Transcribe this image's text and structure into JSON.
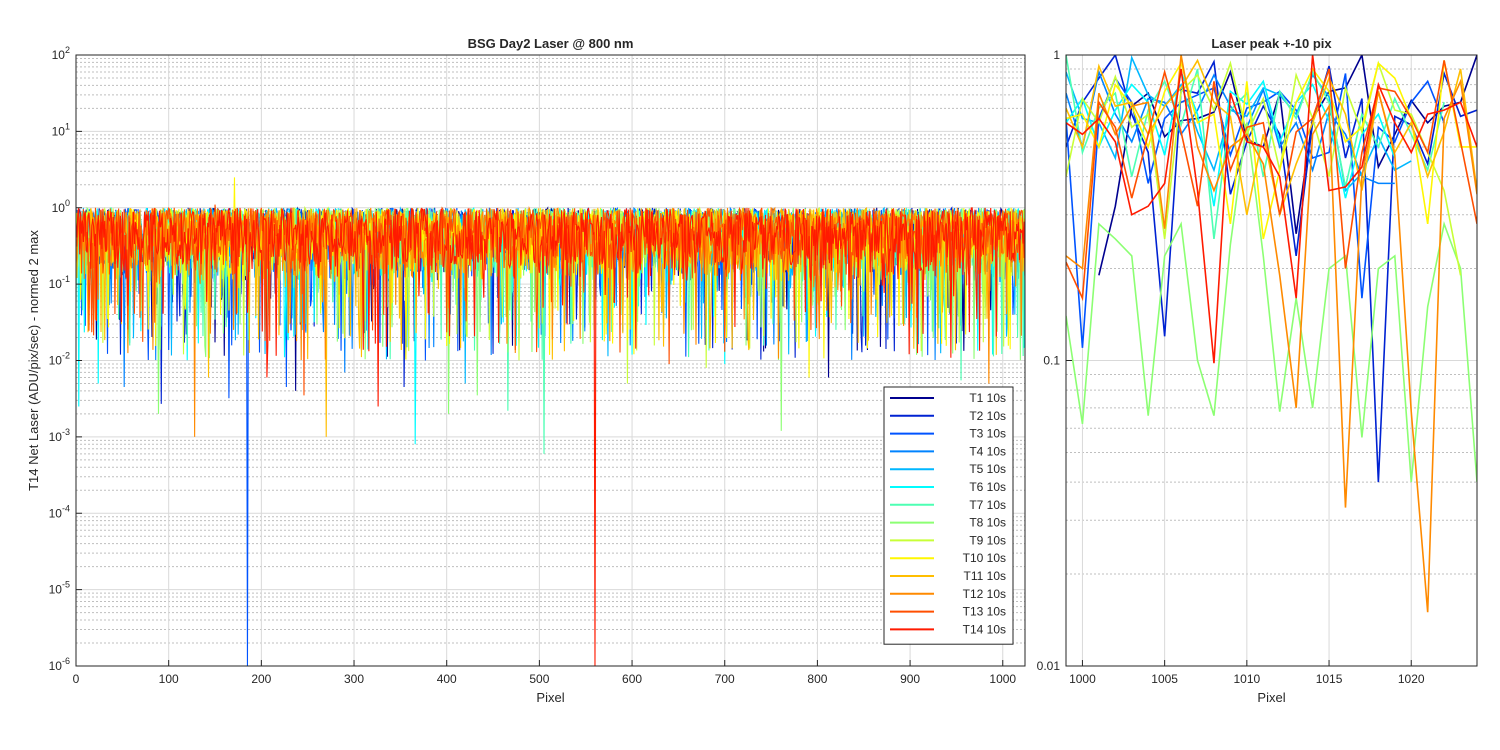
{
  "chart_data": [
    {
      "type": "line",
      "title": "BSG  Day2 Laser @ 800 nm",
      "xlabel": "Pixel",
      "ylabel": "T14 Net Laser (ADU/pix/sec) - normed 2 max",
      "yscale": "log",
      "xlim": [
        0,
        1024
      ],
      "ylim": [
        1e-06,
        100
      ],
      "xticks": [
        0,
        100,
        200,
        300,
        400,
        500,
        600,
        700,
        800,
        900,
        1000
      ],
      "ytick_exponents": [
        -6,
        -5,
        -4,
        -3,
        -2,
        -1,
        0,
        1,
        2
      ],
      "grid": true,
      "minor_grid": true,
      "legend_position": "bottom-right",
      "noise_band": [
        0.1,
        1.0
      ],
      "series": [
        {
          "name": "T1 10s",
          "color": "#00008f",
          "dips": [
            [
              237,
              0.004
            ],
            [
              812,
              0.006
            ]
          ]
        },
        {
          "name": "T2 10s",
          "color": "#0022d2",
          "dips": [
            [
              92,
              0.0027
            ],
            [
              354,
              0.0045
            ]
          ]
        },
        {
          "name": "T3 10s",
          "color": "#0053ff",
          "dips": [
            [
              185,
              1e-06
            ],
            [
              165,
              0.0032
            ],
            [
              227,
              0.0045
            ]
          ]
        },
        {
          "name": "T4 10s",
          "color": "#0083ff",
          "dips": [
            [
              52,
              0.0045
            ],
            [
              290,
              0.007
            ]
          ]
        },
        {
          "name": "T5 10s",
          "color": "#00b7ff",
          "dips": [
            [
              420,
              0.005
            ]
          ]
        },
        {
          "name": "T6 10s",
          "color": "#00fcff",
          "dips": [
            [
              366,
              0.0008
            ],
            [
              3,
              0.0025
            ],
            [
              24,
              0.005
            ],
            [
              700,
              0.009
            ]
          ]
        },
        {
          "name": "T7 10s",
          "color": "#4dffb3",
          "dips": [
            [
              505,
              0.0006
            ],
            [
              466,
              0.0022
            ],
            [
              955,
              0.0055
            ]
          ]
        },
        {
          "name": "T8 10s",
          "color": "#8cff73",
          "dips": [
            [
              89,
              0.002
            ],
            [
              761,
              0.0012
            ],
            [
              402,
              0.002
            ],
            [
              433,
              0.0035
            ]
          ]
        },
        {
          "name": "T9 10s",
          "color": "#c8ff37",
          "dips": [
            [
              595,
              0.005
            ],
            [
              680,
              0.008
            ]
          ]
        },
        {
          "name": "T10 10s",
          "color": "#fff700",
          "dips": [
            [
              171,
              0.0055
            ],
            [
              791,
              0.006
            ]
          ]
        },
        {
          "name": "T11 10s",
          "color": "#ffbe00",
          "dips": [
            [
              270,
              0.001
            ],
            [
              143,
              0.006
            ]
          ]
        },
        {
          "name": "T12 10s",
          "color": "#ff8a00",
          "dips": [
            [
              128,
              0.001
            ],
            [
              985,
              0.005
            ]
          ]
        },
        {
          "name": "T13 10s",
          "color": "#ff4f00",
          "dips": [
            [
              246,
              0.0035
            ],
            [
              640,
              0.009
            ]
          ]
        },
        {
          "name": "T14 10s",
          "color": "#ff1a00",
          "dips": [
            [
              560,
              1e-06
            ],
            [
              326,
              0.0025
            ],
            [
              206,
              0.006
            ]
          ]
        }
      ],
      "spikes": [
        [
          171,
          2.5,
          "T10 10s"
        ],
        [
          150,
          1.1,
          "T13 10s"
        ]
      ]
    },
    {
      "type": "line",
      "title": "Laser peak +-10 pix",
      "xlabel": "Pixel",
      "ylabel": "",
      "yscale": "log",
      "xlim": [
        999,
        1024
      ],
      "ylim": [
        0.01,
        1
      ],
      "xticks": [
        1000,
        1005,
        1010,
        1015,
        1020
      ],
      "ytick_exponents": [
        -2,
        -1,
        0
      ],
      "grid": true,
      "minor_grid": true,
      "series": [
        {
          "name": "T1 10s",
          "color": "#00008f",
          "x": [
            1001,
            1002,
            1003,
            1004,
            1005,
            1006,
            1007,
            1008,
            1009,
            1010,
            1011,
            1012,
            1013,
            1014,
            1015,
            1016,
            1017,
            1018,
            1019,
            1020,
            1021,
            1022,
            1023,
            1024
          ],
          "y": [
            0.19,
            0.32,
            0.68,
            0.75,
            0.54,
            0.61,
            0.62,
            0.65,
            0.88,
            0.53,
            0.5,
            0.75,
            0.26,
            0.62,
            0.76,
            0.78,
            1.0,
            0.43,
            0.55,
            0.71,
            0.6,
            0.68,
            0.7,
            1.0
          ]
        },
        {
          "name": "T2 10s",
          "color": "#0022d2",
          "x": [
            999,
            1000,
            1001,
            1002,
            1003,
            1004,
            1005,
            1006,
            1007,
            1008,
            1009,
            1010,
            1011,
            1012,
            1013,
            1014,
            1015,
            1016,
            1017,
            1018,
            1019,
            1020,
            1021,
            1022,
            1023,
            1024
          ],
          "y": [
            0.5,
            0.7,
            0.84,
            1.0,
            0.64,
            0.48,
            0.12,
            0.77,
            0.75,
            0.95,
            0.35,
            0.52,
            0.68,
            0.55,
            0.22,
            0.6,
            0.92,
            0.46,
            0.72,
            0.04,
            0.63,
            0.59,
            0.44,
            0.87,
            0.63,
            0.66
          ]
        },
        {
          "name": "T3 10s",
          "color": "#0053ff",
          "x": [
            999,
            1000,
            1001,
            1002,
            1003,
            1004,
            1005,
            1006,
            1007,
            1008,
            1009,
            1010,
            1011,
            1012,
            1013,
            1014,
            1015,
            1016,
            1017,
            1018,
            1019,
            1020,
            1021,
            1022
          ],
          "y": [
            0.62,
            0.11,
            0.62,
            0.84,
            0.7,
            0.38,
            0.62,
            0.7,
            0.74,
            0.78,
            0.47,
            0.67,
            0.7,
            0.76,
            0.66,
            0.46,
            0.48,
            0.87,
            0.16,
            0.58,
            0.52,
            0.7,
            0.82,
            0.6
          ]
        },
        {
          "name": "T4 10s",
          "color": "#0083ff",
          "x": [
            999,
            1000,
            1001,
            1002,
            1003,
            1004,
            1005,
            1006,
            1007,
            1008,
            1009,
            1010,
            1011,
            1012,
            1013,
            1014,
            1015,
            1016,
            1017,
            1018,
            1019
          ],
          "y": [
            0.75,
            0.5,
            0.88,
            0.64,
            0.52,
            0.72,
            0.7,
            0.55,
            0.66,
            0.86,
            0.68,
            0.58,
            0.77,
            0.5,
            0.6,
            0.42,
            0.65,
            0.55,
            0.4,
            0.38,
            0.38
          ]
        },
        {
          "name": "T5 10s",
          "color": "#00b7ff",
          "x": [
            999,
            1000,
            1001,
            1002,
            1003,
            1004,
            1005,
            1006,
            1007,
            1008,
            1009,
            1010,
            1011,
            1012,
            1013,
            1014,
            1015,
            1016,
            1017,
            1018,
            1019,
            1020
          ],
          "y": [
            0.88,
            0.62,
            0.6,
            0.46,
            0.98,
            0.74,
            0.68,
            0.8,
            0.56,
            0.42,
            0.66,
            0.63,
            0.78,
            0.74,
            0.64,
            0.86,
            0.73,
            0.36,
            0.41,
            0.54,
            0.42,
            0.45
          ]
        },
        {
          "name": "T6 10s",
          "color": "#00fcff",
          "x": [
            999,
            1000,
            1001,
            1002,
            1003,
            1004,
            1005,
            1006,
            1007,
            1008,
            1009,
            1010,
            1011,
            1012,
            1013,
            1014,
            1015,
            1016,
            1017,
            1018,
            1019
          ],
          "y": [
            0.6,
            0.72,
            0.5,
            0.66,
            0.8,
            0.7,
            0.47,
            0.88,
            0.64,
            0.32,
            0.76,
            0.69,
            0.82,
            0.52,
            0.7,
            0.8,
            0.61,
            0.34,
            0.55,
            0.64,
            0.46
          ]
        },
        {
          "name": "T7 10s",
          "color": "#4dffb3",
          "x": [
            999,
            1000,
            1001,
            1002,
            1003,
            1004,
            1005,
            1006,
            1007,
            1008,
            1009,
            1010,
            1011,
            1012,
            1013,
            1014,
            1015,
            1016,
            1017,
            1018,
            1019,
            1020,
            1021,
            1022
          ],
          "y": [
            1.0,
            0.48,
            0.67,
            0.75,
            0.4,
            0.66,
            0.82,
            0.59,
            0.9,
            0.25,
            0.66,
            0.75,
            0.4,
            0.76,
            0.62,
            0.88,
            0.7,
            0.37,
            0.64,
            0.5,
            0.72,
            0.55,
            0.42,
            0.7
          ]
        },
        {
          "name": "T8 10s",
          "color": "#8cff73",
          "x": [
            999,
            1000,
            1001,
            1002,
            1003,
            1004,
            1005,
            1006,
            1007,
            1008,
            1009,
            1010,
            1011,
            1012,
            1013,
            1014,
            1015,
            1016,
            1017,
            1018,
            1019,
            1020,
            1021,
            1022,
            1023,
            1024
          ],
          "y": [
            0.14,
            0.062,
            0.28,
            0.25,
            0.22,
            0.066,
            0.22,
            0.28,
            0.1,
            0.066,
            0.24,
            0.6,
            0.22,
            0.068,
            0.16,
            0.07,
            0.2,
            0.22,
            0.056,
            0.2,
            0.22,
            0.04,
            0.15,
            0.28,
            0.2,
            0.04
          ]
        },
        {
          "name": "T9 10s",
          "color": "#c8ff37",
          "x": [
            999,
            1000,
            1001,
            1002,
            1003,
            1004,
            1005,
            1006,
            1007,
            1008,
            1009,
            1010,
            1011,
            1012,
            1013,
            1014,
            1015,
            1016,
            1017,
            1018,
            1019,
            1020,
            1021,
            1022,
            1023
          ],
          "y": [
            0.4,
            0.72,
            0.6,
            0.85,
            0.58,
            0.64,
            0.25,
            0.76,
            0.86,
            0.66,
            0.94,
            0.55,
            0.72,
            0.42,
            0.86,
            0.62,
            0.4,
            0.78,
            0.56,
            0.94,
            0.66,
            0.64,
            0.48,
            0.36,
            0.19
          ]
        },
        {
          "name": "T10 10s",
          "color": "#fff700",
          "x": [
            999,
            1000,
            1001,
            1002,
            1003,
            1004,
            1005,
            1006,
            1007,
            1008,
            1009,
            1010,
            1011,
            1012,
            1013,
            1014,
            1015,
            1016,
            1017,
            1018,
            1019,
            1020,
            1021,
            1022,
            1023,
            1024
          ],
          "y": [
            0.62,
            0.64,
            0.5,
            0.8,
            0.68,
            0.5,
            0.76,
            0.94,
            0.6,
            0.64,
            0.28,
            0.82,
            0.25,
            0.42,
            0.7,
            0.9,
            0.76,
            0.52,
            0.58,
            0.94,
            0.84,
            0.62,
            0.28,
            0.96,
            0.5,
            0.5
          ]
        },
        {
          "name": "T11 10s",
          "color": "#ffbe00",
          "x": [
            999,
            1000,
            1001,
            1002,
            1003,
            1004,
            1005,
            1006,
            1007,
            1008,
            1009,
            1010,
            1011,
            1012,
            1013,
            1014,
            1015,
            1016,
            1017,
            1018,
            1019,
            1020,
            1021,
            1022,
            1023,
            1024
          ],
          "y": [
            0.67,
            0.5,
            0.92,
            0.68,
            0.7,
            0.55,
            0.68,
            0.78,
            0.96,
            0.7,
            0.63,
            0.3,
            0.55,
            0.3,
            0.44,
            0.6,
            0.84,
            0.64,
            0.36,
            0.76,
            0.48,
            0.6,
            0.4,
            0.56,
            0.9,
            0.36
          ]
        },
        {
          "name": "T12 10s",
          "color": "#ff8a00",
          "x": [
            999,
            1000,
            1001,
            1002,
            1003,
            1004,
            1005,
            1006,
            1007,
            1008,
            1009,
            1010,
            1011,
            1012,
            1013,
            1014,
            1015,
            1016,
            1017,
            1018,
            1019,
            1020,
            1021,
            1022,
            1023,
            1024
          ],
          "y": [
            0.22,
            0.2,
            0.75,
            0.55,
            0.68,
            0.7,
            0.27,
            1.0,
            0.5,
            0.36,
            0.5,
            0.55,
            0.44,
            0.19,
            0.07,
            0.55,
            0.68,
            0.033,
            0.4,
            0.76,
            0.47,
            0.068,
            0.015,
            0.62,
            0.82,
            0.35
          ]
        },
        {
          "name": "T13 10s",
          "color": "#ff4f00",
          "x": [
            999,
            1000,
            1001,
            1002,
            1003,
            1004,
            1005,
            1006,
            1007,
            1008,
            1009,
            1010,
            1011,
            1012,
            1013,
            1014,
            1015,
            1016,
            1017,
            1018,
            1019,
            1020,
            1021,
            1022,
            1023,
            1024
          ],
          "y": [
            0.21,
            0.16,
            0.7,
            0.58,
            0.34,
            0.55,
            0.88,
            0.56,
            0.32,
            0.82,
            0.42,
            0.58,
            0.6,
            0.3,
            0.56,
            0.62,
            0.9,
            0.2,
            0.48,
            0.78,
            0.76,
            0.62,
            0.48,
            0.96,
            0.52,
            0.28
          ]
        },
        {
          "name": "T14 10s",
          "color": "#ff1a00",
          "x": [
            999,
            1000,
            1001,
            1002,
            1003,
            1004,
            1005,
            1006,
            1007,
            1008,
            1009,
            1010,
            1011,
            1012,
            1013,
            1014,
            1015,
            1016,
            1017,
            1018,
            1019,
            1020,
            1021,
            1022,
            1023,
            1024
          ],
          "y": [
            0.6,
            0.55,
            0.62,
            0.52,
            0.3,
            0.32,
            0.38,
            0.9,
            0.36,
            0.098,
            0.75,
            0.52,
            0.5,
            0.4,
            0.16,
            1.0,
            0.36,
            0.37,
            0.43,
            0.8,
            0.6,
            0.48,
            0.64,
            0.66,
            0.7,
            0.5
          ]
        }
      ]
    }
  ]
}
